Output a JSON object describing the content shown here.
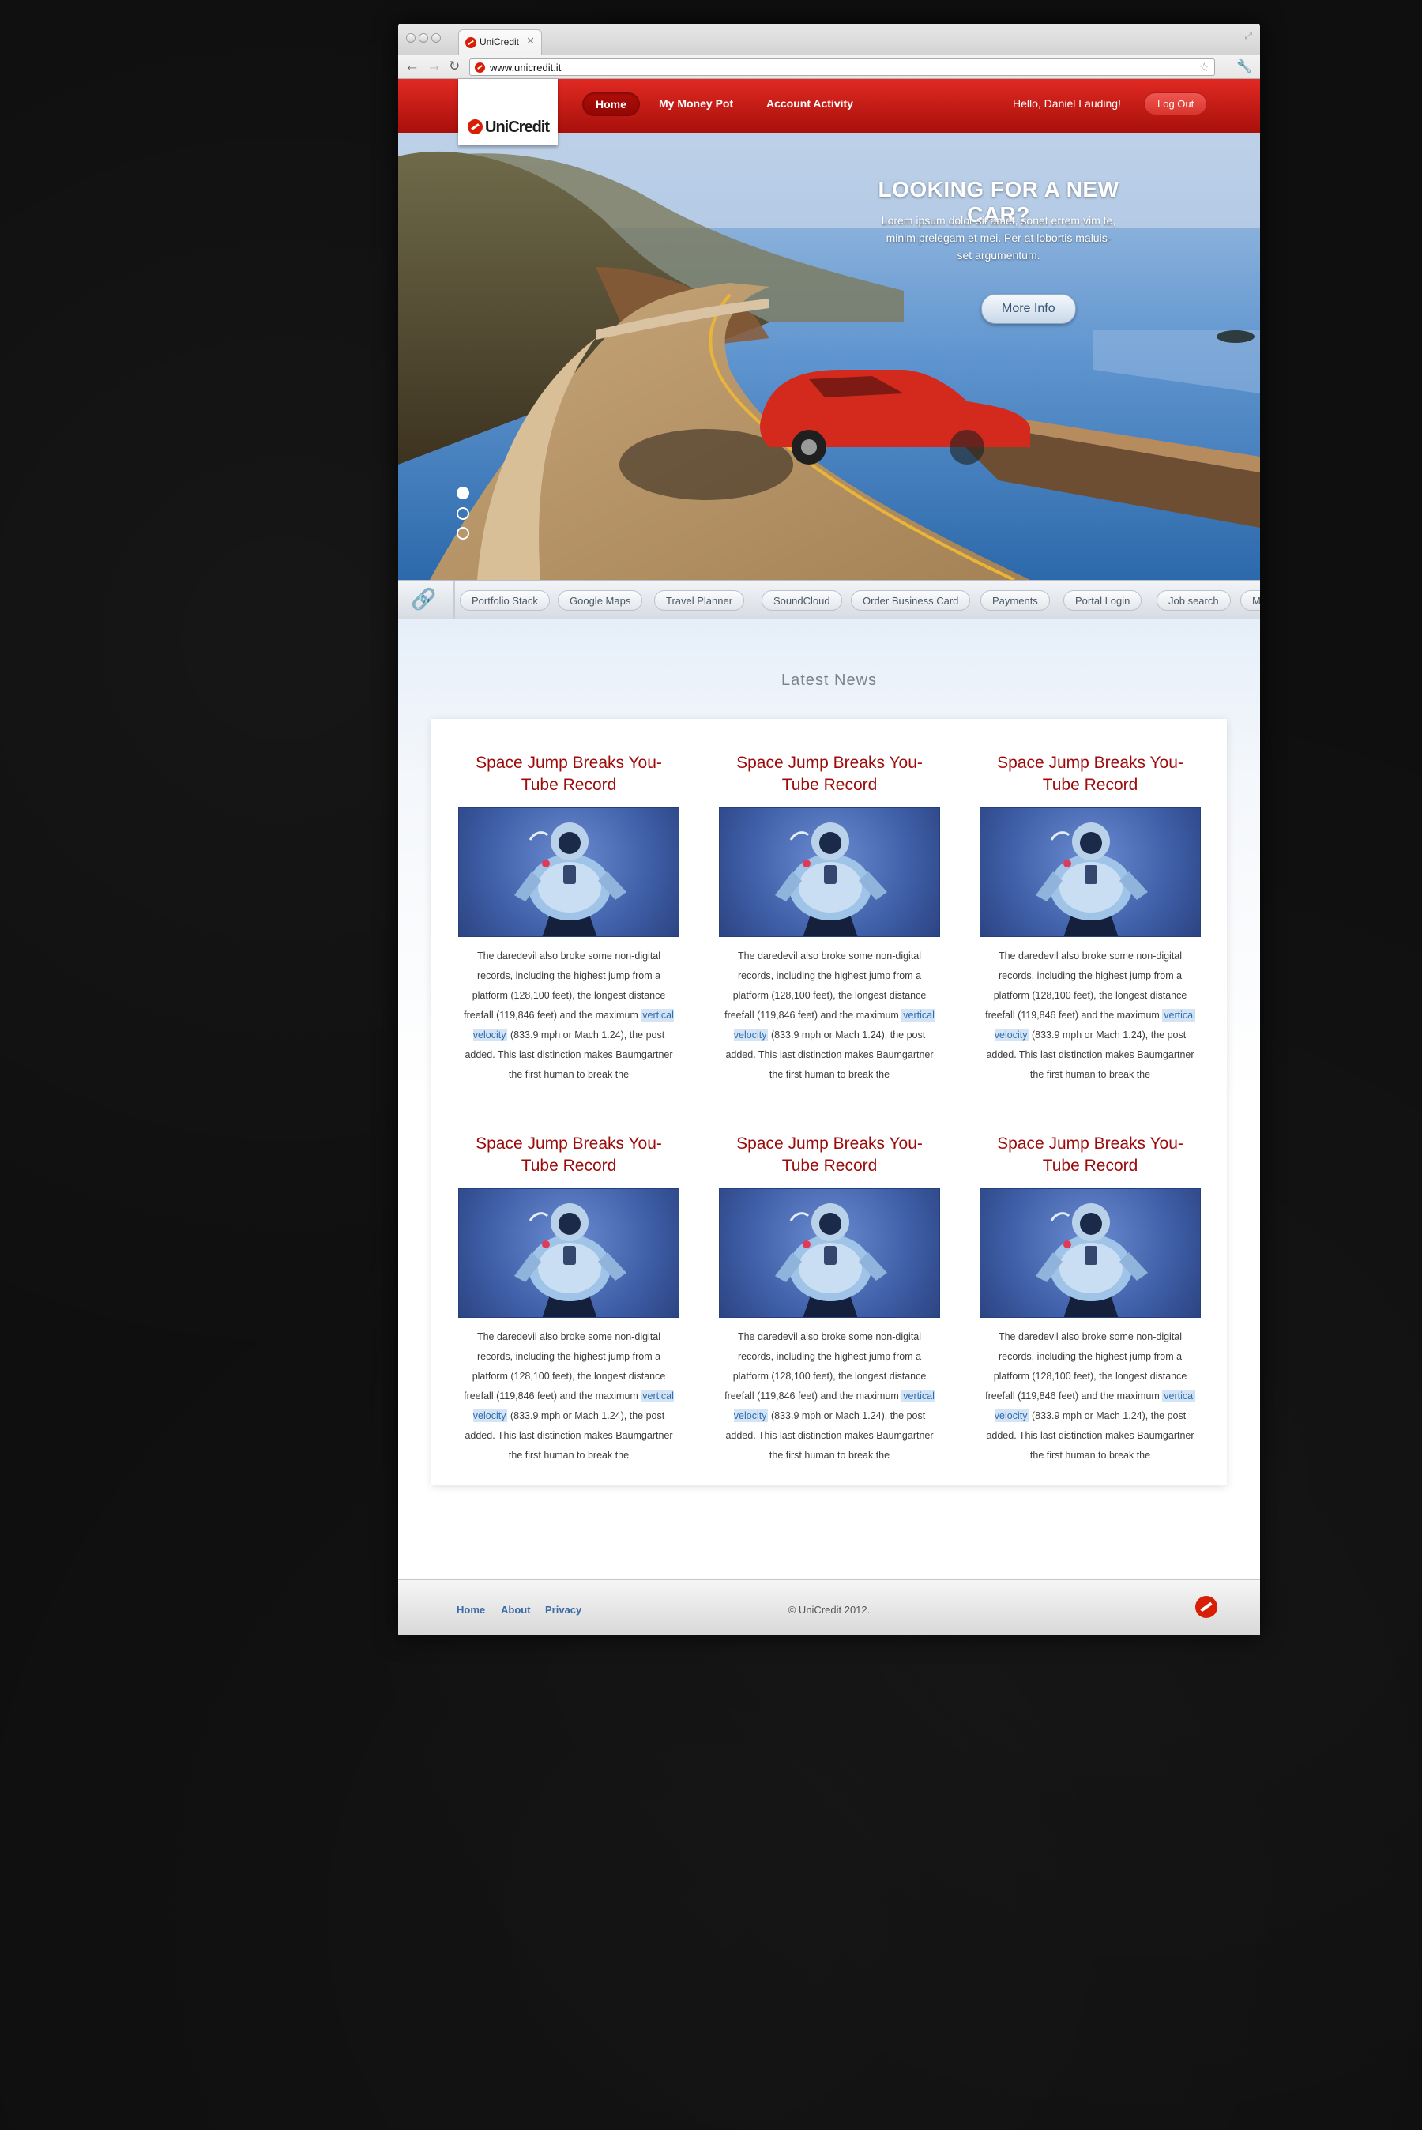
{
  "browser": {
    "tab_title": "UniCredit",
    "url": "www.unicredit.it"
  },
  "header": {
    "logo_text": "UniCredit",
    "nav": [
      "Home",
      "My Money Pot",
      "Account Activity"
    ],
    "greeting": "Hello,  Daniel Lauding!",
    "logout_label": "Log Out"
  },
  "hero": {
    "title": "LOOKING FOR A NEW CAR?",
    "text": "Lorem ipsum dolor sit amet, sonet errem vim te, minim prelegam et mei. Per at lobortis maluis-set argumentum.",
    "button_label": "More Info",
    "slides_total": 3,
    "active_slide": 1
  },
  "quicklinks": [
    "Portfolio Stack",
    "Google Maps",
    "Travel Planner",
    "SoundCloud",
    "Order Business Card",
    "Payments",
    "Portal Login",
    "Job search",
    "M"
  ],
  "news": {
    "title": "Latest News",
    "cards": [
      {
        "title": "Space Jump Breaks You-Tube Record",
        "pre": "The daredevil also broke some non-digital records, including the highest jump from a platform (128,100 feet), the longest distance freefall (119,846 feet) and the maximum ",
        "link": "vertical velocity",
        "post": " (833.9 mph or Mach 1.24), the post added. This last distinction makes Baumgartner the first human to break the"
      },
      {
        "title": "Space Jump Breaks You-Tube Record",
        "pre": "The daredevil also broke some non-digital records, including the highest jump from a platform (128,100 feet), the longest distance freefall (119,846 feet) and the maximum ",
        "link": "vertical velocity",
        "post": " (833.9 mph or Mach 1.24), the post added. This last distinction makes Baumgartner the first human to break the"
      },
      {
        "title": "Space Jump Breaks You-Tube Record",
        "pre": "The daredevil also broke some non-digital records, including the highest jump from a platform (128,100 feet), the longest distance freefall (119,846 feet) and the maximum ",
        "link": "vertical velocity",
        "post": " (833.9 mph or Mach 1.24), the post added. This last distinction makes Baumgartner the first human to break the"
      },
      {
        "title": "Space Jump Breaks You-Tube Record",
        "pre": "The daredevil also broke some non-digital records, including the highest jump from a platform (128,100 feet), the longest distance freefall (119,846 feet) and the maximum ",
        "link": "vertical velocity",
        "post": " (833.9 mph or Mach 1.24), the post added. This last distinction makes Baumgartner the first human to break the"
      },
      {
        "title": "Space Jump Breaks You-Tube Record",
        "pre": "The daredevil also broke some non-digital records, including the highest jump from a platform (128,100 feet), the longest distance freefall (119,846 feet) and the maximum ",
        "link": "vertical velocity",
        "post": " (833.9 mph or Mach 1.24), the post added. This last distinction makes Baumgartner the first human to break the"
      },
      {
        "title": "Space Jump Breaks You-Tube Record",
        "pre": "The daredevil also broke some non-digital records, including the highest jump from a platform (128,100 feet), the longest distance freefall (119,846 feet) and the maximum ",
        "link": "vertical velocity",
        "post": " (833.9 mph or Mach 1.24), the post added. This last distinction makes Baumgartner the first human to break the"
      }
    ]
  },
  "footer": {
    "links": [
      "Home",
      "About",
      "Privacy"
    ],
    "copyright": "© UniCredit 2012."
  },
  "colors": {
    "brand_red": "#d81e05",
    "news_title": "#9c0a0a",
    "link_blue": "#3b6aa5"
  },
  "icons": [
    "unicredit-logo-icon",
    "back-arrow-icon",
    "forward-arrow-icon",
    "reload-icon",
    "star-icon",
    "wrench-icon",
    "link-chain-icon",
    "close-icon"
  ]
}
